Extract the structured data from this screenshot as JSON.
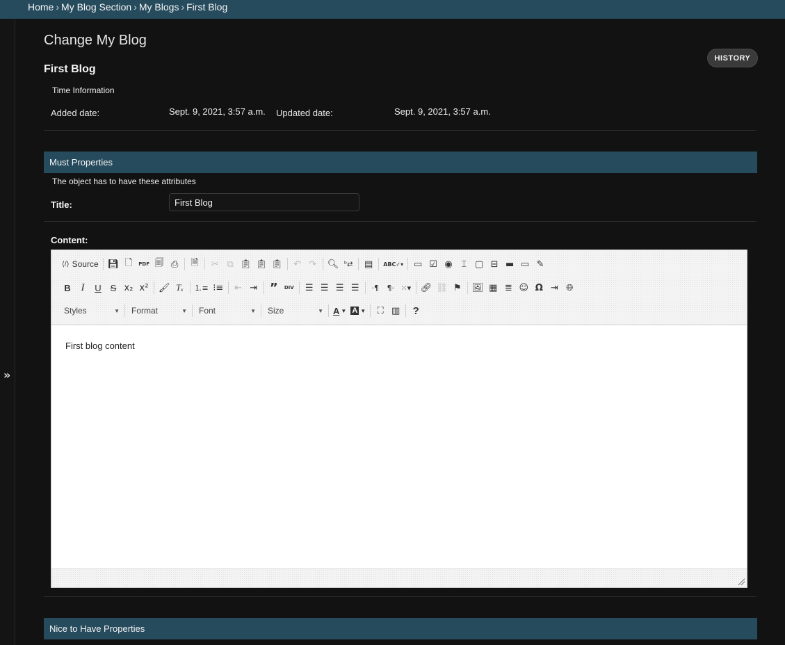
{
  "breadcrumbs": {
    "items": [
      "Home",
      "My Blog Section",
      "My Blogs",
      "First Blog"
    ],
    "separator": "›"
  },
  "nav": {
    "toggle_glyph": "»"
  },
  "page": {
    "title": "Change My Blog",
    "history_label": "HISTORY",
    "object_name": "First Blog"
  },
  "time_info": {
    "legend": "Time Information",
    "added_label": "Added date:",
    "added_value": "Sept. 9, 2021, 3:57 a.m.",
    "updated_label": "Updated date:",
    "updated_value": "Sept. 9, 2021, 3:57 a.m."
  },
  "must_properties": {
    "header": "Must Properties",
    "description": "The object has to have these attributes",
    "title_label": "Title:",
    "title_value": "First Blog",
    "content_label": "Content:"
  },
  "editor": {
    "source_label": "Source",
    "combos": {
      "styles": "Styles",
      "format": "Format",
      "font": "Font",
      "size": "Size"
    },
    "content": "First blog content"
  },
  "nice_properties": {
    "header": "Nice to Have Properties"
  },
  "colors": {
    "accent": "#264b5d",
    "background": "#121212"
  }
}
